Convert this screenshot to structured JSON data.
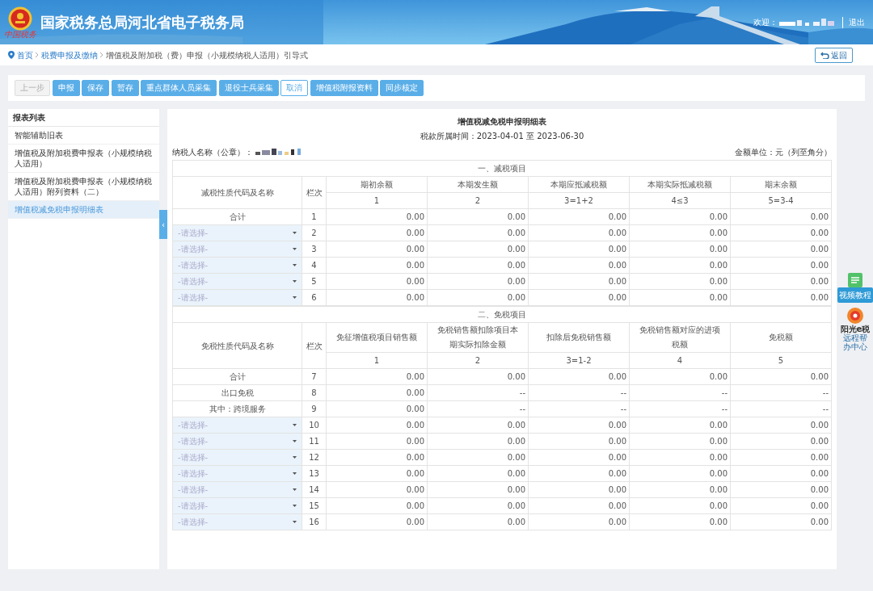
{
  "header": {
    "title": "国家税务总局河北省电子税务局",
    "emblem_caption": "中国税务",
    "welcome": "欢迎：",
    "logout": "退出"
  },
  "breadcrumb": {
    "items": [
      "首页",
      "税费申报及缴纳",
      "增值税及附加税（费）申报（小规模纳税人适用）引导式"
    ],
    "back": "返回"
  },
  "toolbar": [
    {
      "label": "上一步",
      "kind": "disabled"
    },
    {
      "label": "申报",
      "kind": "primary"
    },
    {
      "label": "保存",
      "kind": "primary"
    },
    {
      "label": "暂存",
      "kind": "primary"
    },
    {
      "label": "重点群体人员采集",
      "kind": "primary"
    },
    {
      "label": "退役士兵采集",
      "kind": "primary"
    },
    {
      "label": "取消",
      "kind": "outline"
    },
    {
      "label": "增值税附报资料",
      "kind": "primary"
    },
    {
      "label": "同步核定",
      "kind": "primary"
    }
  ],
  "sidebar": {
    "title": "报表列表",
    "items": [
      {
        "label": "智能辅助旧表",
        "selected": false
      },
      {
        "label": "增值税及附加税费申报表（小规模纳税人适用）",
        "selected": false
      },
      {
        "label": "增值税及附加税费申报表（小规模纳税人适用）附列资料（二）",
        "selected": false
      },
      {
        "label": "增值税减免税申报明细表",
        "selected": true
      }
    ],
    "collapse": "‹"
  },
  "form": {
    "title": "增值税减免税申报明细表",
    "period": "税款所属时间：2023-04-01 至 2023-06-30",
    "taxpayer_label": "纳税人名称（公章）：",
    "unit": "金额单位：元（列至角分）",
    "sections": [
      {
        "title": "一、减税项目",
        "name_header": "减税性质代码及名称",
        "line_header": "栏次",
        "columns": [
          "期初余额",
          "本期发生额",
          "本期应抵减税额",
          "本期实际抵减税额",
          "期末余额"
        ],
        "codes": [
          "1",
          "2",
          "3=1+2",
          "4≤3",
          "5=3-4"
        ],
        "rows": [
          {
            "kind": "label",
            "label": "合计",
            "line": "1",
            "values": [
              "0.00",
              "0.00",
              "0.00",
              "0.00",
              "0.00"
            ]
          },
          {
            "kind": "select",
            "label": "-请选择-",
            "line": "2",
            "values": [
              "0.00",
              "0.00",
              "0.00",
              "0.00",
              "0.00"
            ]
          },
          {
            "kind": "select",
            "label": "-请选择-",
            "line": "3",
            "values": [
              "0.00",
              "0.00",
              "0.00",
              "0.00",
              "0.00"
            ]
          },
          {
            "kind": "select",
            "label": "-请选择-",
            "line": "4",
            "values": [
              "0.00",
              "0.00",
              "0.00",
              "0.00",
              "0.00"
            ]
          },
          {
            "kind": "select",
            "label": "-请选择-",
            "line": "5",
            "values": [
              "0.00",
              "0.00",
              "0.00",
              "0.00",
              "0.00"
            ]
          },
          {
            "kind": "select",
            "label": "-请选择-",
            "line": "6",
            "values": [
              "0.00",
              "0.00",
              "0.00",
              "0.00",
              "0.00"
            ]
          }
        ]
      },
      {
        "title": "二、免税项目",
        "name_header": "免税性质代码及名称",
        "line_header": "栏次",
        "columns": [
          "免征增值税项目销售额",
          "免税销售额扣除项目本期实际扣除金额",
          "扣除后免税销售额",
          "免税销售额对应的进项税额",
          "免税额"
        ],
        "codes": [
          "1",
          "2",
          "3=1-2",
          "4",
          "5"
        ],
        "rows": [
          {
            "kind": "label",
            "label": "合计",
            "line": "7",
            "values": [
              "0.00",
              "0.00",
              "0.00",
              "0.00",
              "0.00"
            ]
          },
          {
            "kind": "label",
            "label": "出口免税",
            "line": "8",
            "values": [
              "0.00",
              "--",
              "--",
              "--",
              "--"
            ]
          },
          {
            "kind": "label",
            "label": "其中：跨境服务",
            "line": "9",
            "values": [
              "0.00",
              "--",
              "--",
              "--",
              "--"
            ]
          },
          {
            "kind": "select",
            "label": "-请选择-",
            "line": "10",
            "values": [
              "0.00",
              "0.00",
              "0.00",
              "0.00",
              "0.00"
            ]
          },
          {
            "kind": "select",
            "label": "-请选择-",
            "line": "11",
            "values": [
              "0.00",
              "0.00",
              "0.00",
              "0.00",
              "0.00"
            ]
          },
          {
            "kind": "select",
            "label": "-请选择-",
            "line": "12",
            "values": [
              "0.00",
              "0.00",
              "0.00",
              "0.00",
              "0.00"
            ]
          },
          {
            "kind": "select",
            "label": "-请选择-",
            "line": "13",
            "values": [
              "0.00",
              "0.00",
              "0.00",
              "0.00",
              "0.00"
            ]
          },
          {
            "kind": "select",
            "label": "-请选择-",
            "line": "14",
            "values": [
              "0.00",
              "0.00",
              "0.00",
              "0.00",
              "0.00"
            ]
          },
          {
            "kind": "select",
            "label": "-请选择-",
            "line": "15",
            "values": [
              "0.00",
              "0.00",
              "0.00",
              "0.00",
              "0.00"
            ]
          },
          {
            "kind": "select",
            "label": "-请选择-",
            "line": "16",
            "values": [
              "0.00",
              "0.00",
              "0.00",
              "0.00",
              "0.00"
            ]
          }
        ]
      }
    ]
  },
  "floating": {
    "video": "视频教程",
    "brand": "阳光e税",
    "brand_sub": "远程帮办中心"
  }
}
